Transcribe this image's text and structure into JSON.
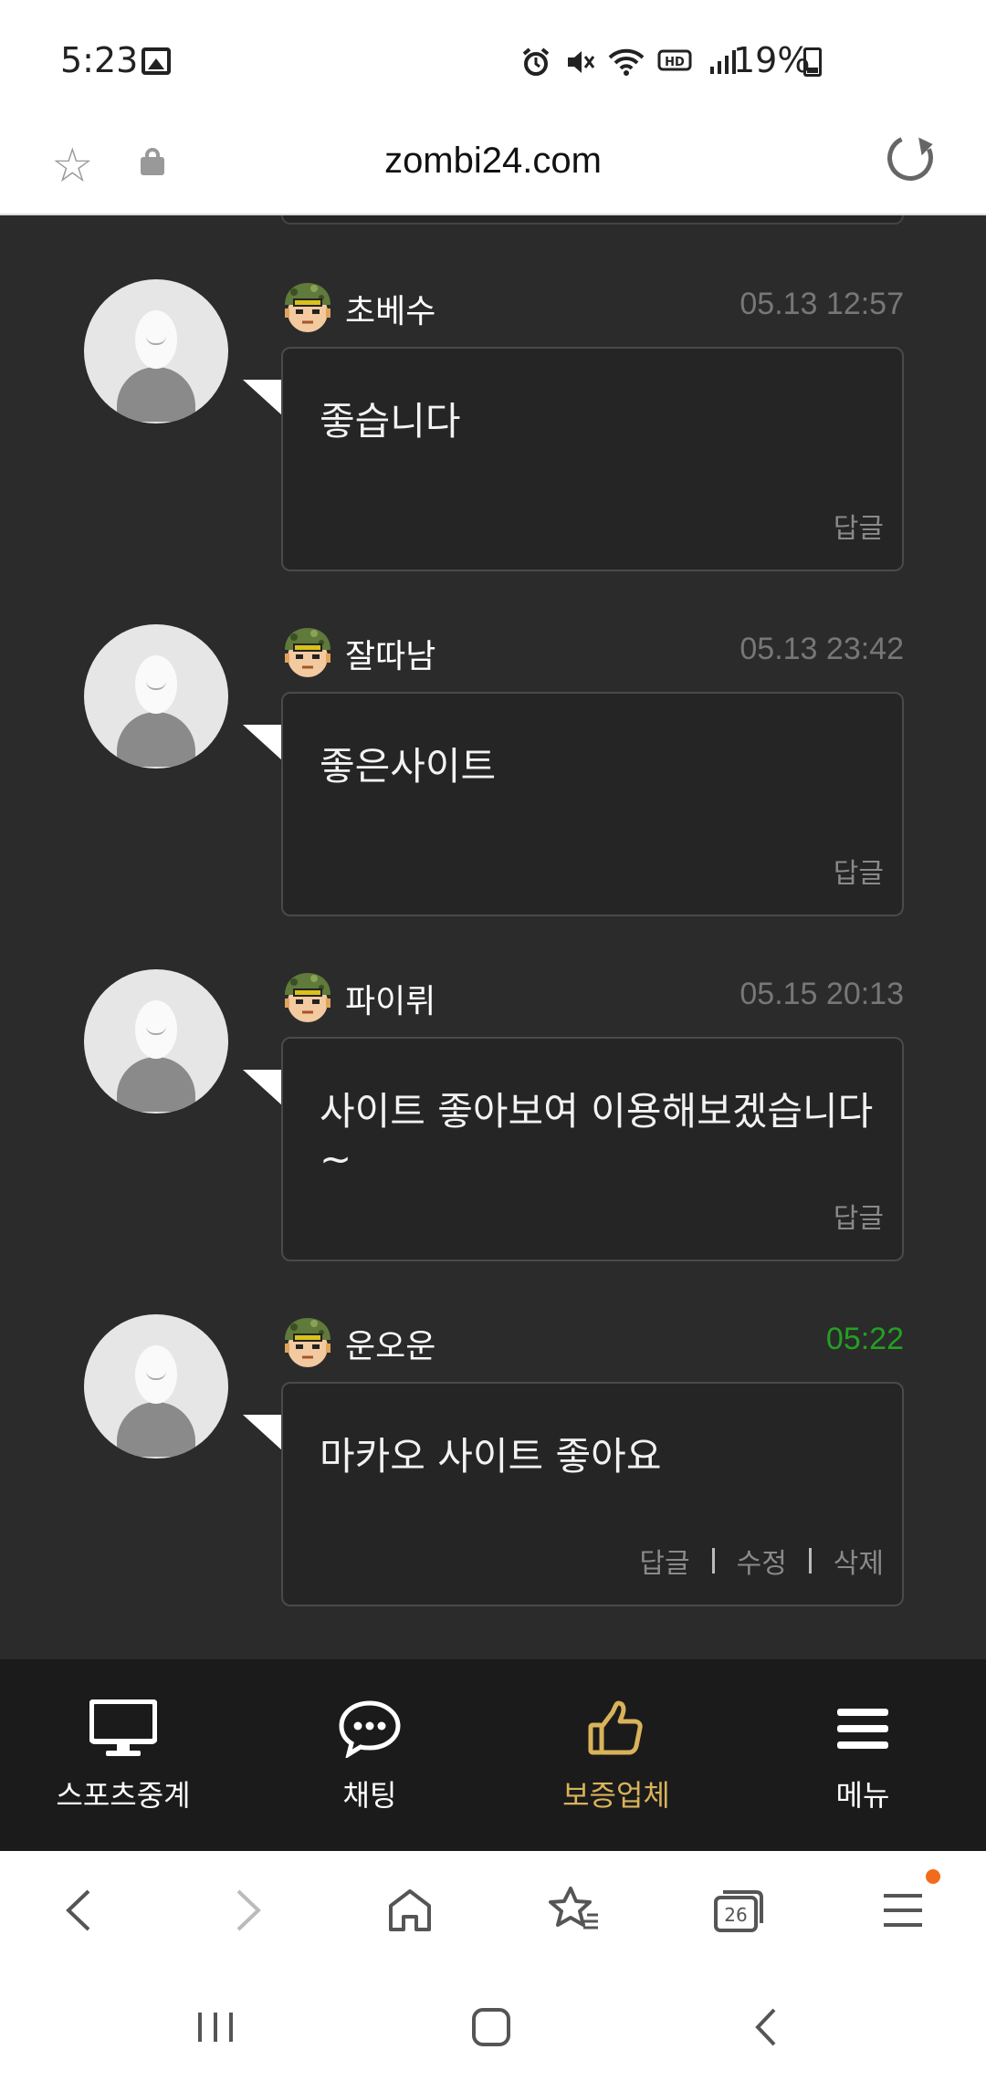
{
  "status_bar": {
    "time": "5:23",
    "battery": "19%",
    "icons": [
      "alarm-icon",
      "mute-icon",
      "wifi-icon",
      "hd-voice-icon",
      "signal-icon",
      "battery-icon"
    ]
  },
  "url_bar": {
    "url": "zombi24.com"
  },
  "comments": [
    {
      "username": "초베수",
      "timestamp": "05.13 12:57",
      "text": "좋습니다",
      "actions": [
        "답글"
      ],
      "is_new": false
    },
    {
      "username": "잘따남",
      "timestamp": "05.13 23:42",
      "text": "좋은사이트",
      "actions": [
        "답글"
      ],
      "is_new": false
    },
    {
      "username": "파이뤼",
      "timestamp": "05.15 20:13",
      "text": "사이트 좋아보여 이용해보겠습니다~",
      "actions": [
        "답글"
      ],
      "is_new": false
    },
    {
      "username": "운오운",
      "timestamp": "05:22",
      "text": "마카오 사이트 좋아요",
      "actions": [
        "답글",
        "수정",
        "삭제"
      ],
      "is_new": true
    }
  ],
  "site_nav": {
    "items": [
      {
        "label": "스포츠중계",
        "icon": "monitor-icon",
        "active": false
      },
      {
        "label": "채팅",
        "icon": "chat-bubble-icon",
        "active": false
      },
      {
        "label": "보증업체",
        "icon": "thumbs-up-icon",
        "active": true
      },
      {
        "label": "메뉴",
        "icon": "hamburger-icon",
        "active": false
      }
    ],
    "active_color": "#d9b35a"
  },
  "browser_toolbar": {
    "tab_count": "26"
  },
  "colors": {
    "background": "#2b2b2b",
    "new_timestamp": "#23a023",
    "notification_dot": "#f26b1d"
  }
}
